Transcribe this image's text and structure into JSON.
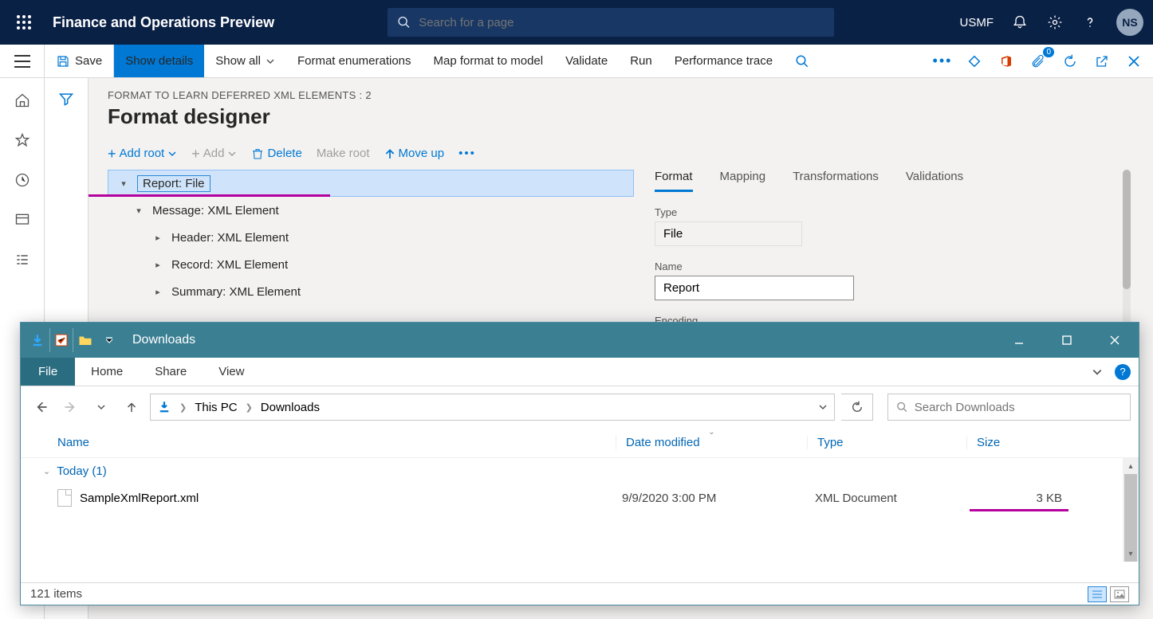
{
  "header": {
    "app_title": "Finance and Operations Preview",
    "search_placeholder": "Search for a page",
    "company": "USMF",
    "user_initials": "NS"
  },
  "action_bar": {
    "save": "Save",
    "show_details": "Show details",
    "show_all": "Show all",
    "format_enums": "Format enumerations",
    "map_format": "Map format to model",
    "validate": "Validate",
    "run": "Run",
    "perf_trace": "Performance trace",
    "badge": "0"
  },
  "page": {
    "breadcrumb": "FORMAT TO LEARN DEFERRED XML ELEMENTS : 2",
    "title": "Format designer"
  },
  "toolbar": {
    "add_root": "Add root",
    "add": "Add",
    "delete": "Delete",
    "make_root": "Make root",
    "move_up": "Move up"
  },
  "tree": {
    "root": "Report: File",
    "n1": "Message: XML Element",
    "n2": "Header: XML Element",
    "n3": "Record: XML Element",
    "n4": "Summary: XML Element"
  },
  "props": {
    "tabs": {
      "format": "Format",
      "mapping": "Mapping",
      "transformations": "Transformations",
      "validations": "Validations"
    },
    "type_label": "Type",
    "type_value": "File",
    "name_label": "Name",
    "name_value": "Report",
    "encoding_label": "Encoding"
  },
  "explorer": {
    "title": "Downloads",
    "ribbon": {
      "file": "File",
      "home": "Home",
      "share": "Share",
      "view": "View"
    },
    "path": {
      "root": "This PC",
      "folder": "Downloads"
    },
    "search_placeholder": "Search Downloads",
    "columns": {
      "name": "Name",
      "date": "Date modified",
      "type": "Type",
      "size": "Size"
    },
    "group": "Today (1)",
    "file": {
      "name": "SampleXmlReport.xml",
      "date": "9/9/2020 3:00 PM",
      "type": "XML Document",
      "size": "3 KB"
    },
    "status": "121 items"
  }
}
